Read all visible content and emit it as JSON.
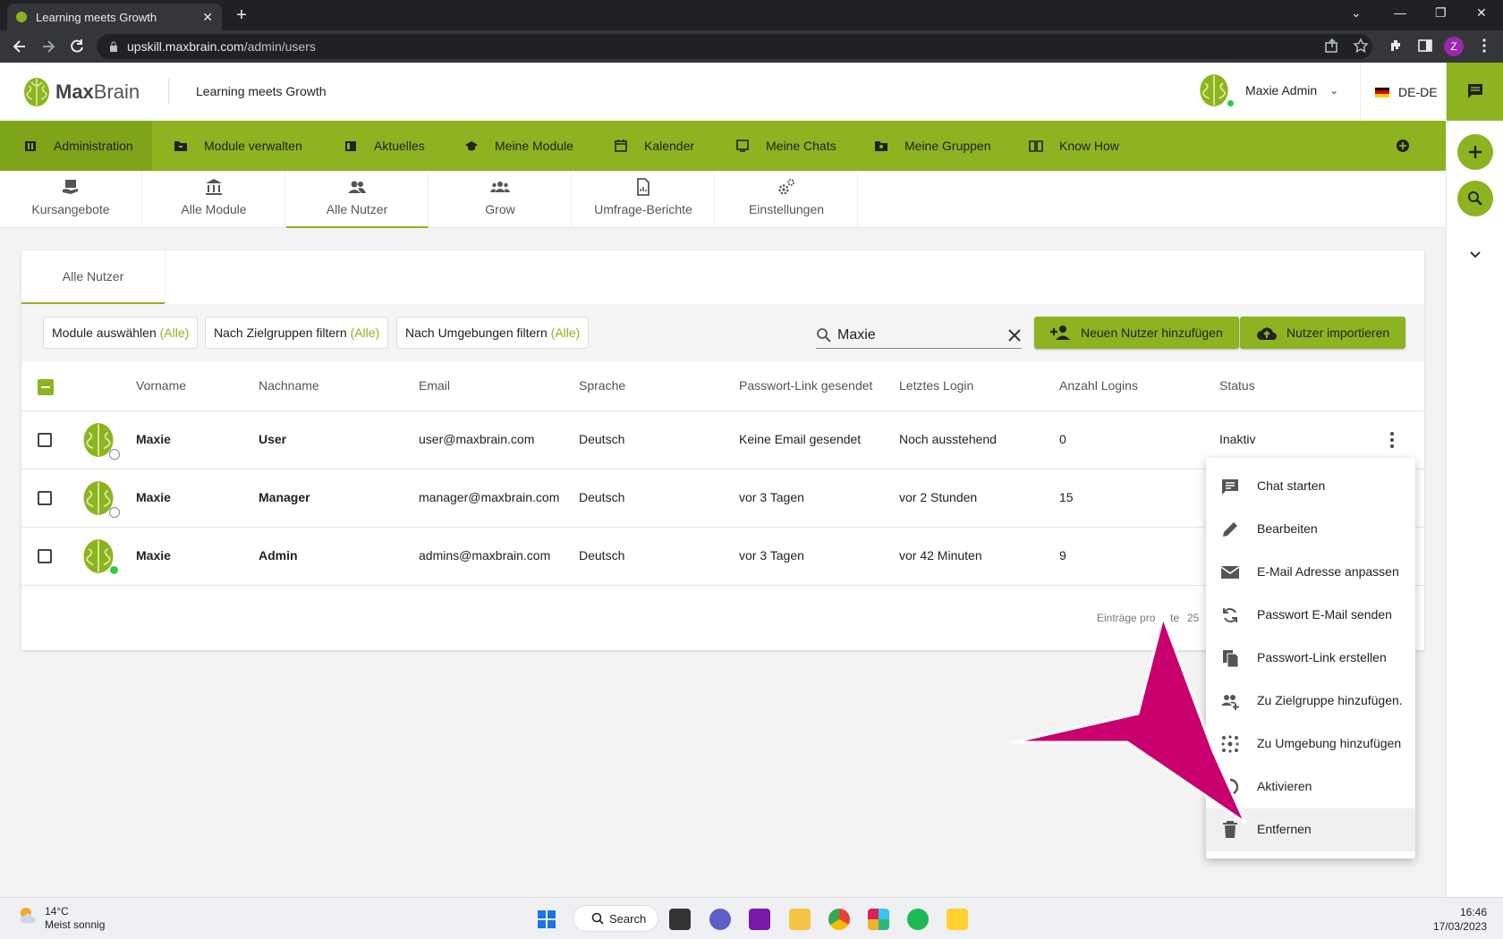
{
  "browser": {
    "tab_title": "Learning meets Growth",
    "url_host": "upskill.maxbrain.com",
    "url_path": "/admin/users",
    "profile_initial": "Z"
  },
  "header": {
    "logo_max": "Max",
    "logo_brain": "Brain",
    "tagline": "Learning meets Growth",
    "user_name": "Maxie Admin",
    "language": "DE-DE"
  },
  "nav": {
    "items": [
      {
        "label": "Administration",
        "icon": "admin-icon"
      },
      {
        "label": "Module verwalten",
        "icon": "folder-icon"
      },
      {
        "label": "Aktuelles",
        "icon": "news-icon"
      },
      {
        "label": "Meine Module",
        "icon": "graduation-cap-icon"
      },
      {
        "label": "Kalender",
        "icon": "calendar-icon"
      },
      {
        "label": "Meine Chats",
        "icon": "chat-icon"
      },
      {
        "label": "Meine Gruppen",
        "icon": "group-folder-icon"
      },
      {
        "label": "Know How",
        "icon": "book-icon"
      }
    ]
  },
  "subnav": {
    "tabs": [
      {
        "label": "Kursangebote"
      },
      {
        "label": "Alle Module"
      },
      {
        "label": "Alle Nutzer"
      },
      {
        "label": "Grow"
      },
      {
        "label": "Umfrage-Berichte"
      },
      {
        "label": "Einstellungen"
      }
    ]
  },
  "card": {
    "tab_label": "Alle Nutzer",
    "filters": {
      "modules": "Module auswählen",
      "targets": "Nach Zielgruppen filtern",
      "environments": "Nach Umgebungen filtern",
      "all_suffix": "(Alle)"
    },
    "search_value": "Maxie",
    "add_user_label": "Neuen Nutzer hinzufügen",
    "import_label": "Nutzer importieren",
    "columns": [
      "Vorname",
      "Nachname",
      "Email",
      "Sprache",
      "Passwort-Link gesendet",
      "Letztes Login",
      "Anzahl Logins",
      "Status"
    ],
    "rows": [
      {
        "vorname": "Maxie",
        "nachname": "User",
        "email": "user@maxbrain.com",
        "sprache": "Deutsch",
        "passwort_link": "Keine Email gesendet",
        "letztes_login": "Noch ausstehend",
        "logins": "0",
        "status": "Inaktiv"
      },
      {
        "vorname": "Maxie",
        "nachname": "Manager",
        "email": "manager@maxbrain.com",
        "sprache": "Deutsch",
        "passwort_link": "vor 3 Tagen",
        "letztes_login": "vor 2 Stunden",
        "logins": "15",
        "status": ""
      },
      {
        "vorname": "Maxie",
        "nachname": "Admin",
        "email": "admins@maxbrain.com",
        "sprache": "Deutsch",
        "passwort_link": "vor 3 Tagen",
        "letztes_login": "vor 42 Minuten",
        "logins": "9",
        "status": ""
      }
    ],
    "paging_label": "Einträge pro",
    "paging_fragment": "te",
    "paging_value": "25"
  },
  "context_menu": {
    "items": [
      {
        "label": "Chat starten",
        "icon": "chat-bubble-icon"
      },
      {
        "label": "Bearbeiten",
        "icon": "pencil-icon"
      },
      {
        "label": "E-Mail Adresse anpassen",
        "icon": "envelope-icon"
      },
      {
        "label": "Passwort E-Mail senden",
        "icon": "sync-icon"
      },
      {
        "label": "Passwort-Link erstellen",
        "icon": "copy-file-icon"
      },
      {
        "label": "Zu Zielgruppe hinzufügen.",
        "icon": "group-add-icon"
      },
      {
        "label": "Zu Umgebung hinzufügen",
        "icon": "dots-grid-icon"
      },
      {
        "label": "Aktivieren",
        "icon": "activate-icon"
      },
      {
        "label": "Entfernen",
        "icon": "trash-icon"
      }
    ],
    "hovered_index": 8
  },
  "taskbar": {
    "temperature": "14°C",
    "weather": "Meist sonnig",
    "search_label": "Search",
    "time": "16:46",
    "date": "17/03/2023"
  },
  "colors": {
    "brand_green": "#8db320",
    "annotation_magenta": "#c8006e"
  }
}
